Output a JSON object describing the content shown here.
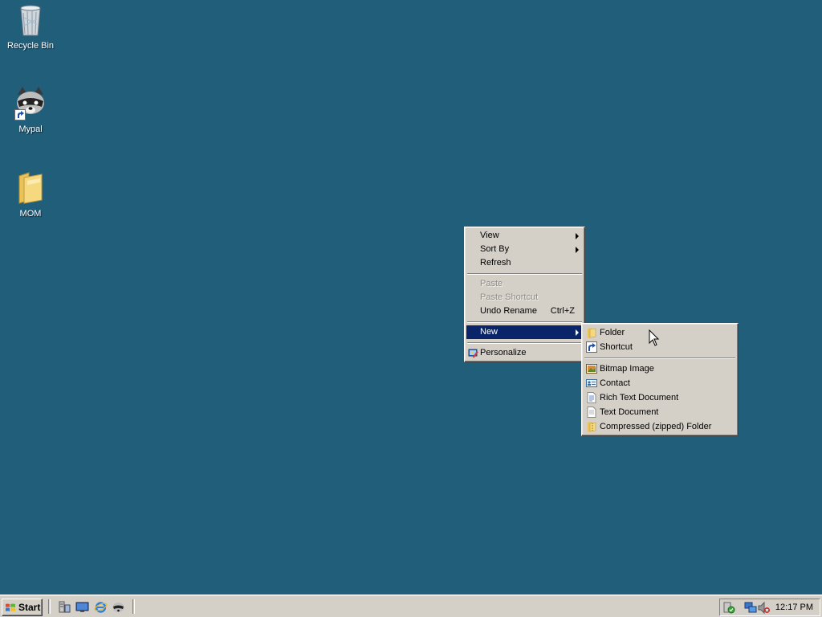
{
  "desktop": {
    "icons": [
      {
        "label": "Recycle Bin",
        "icon": "recycle-bin-icon"
      },
      {
        "label": "Mypal",
        "icon": "raccoon-app-icon"
      },
      {
        "label": "MOM",
        "icon": "folder-icon"
      }
    ]
  },
  "context_menu": {
    "items": [
      {
        "label": "View",
        "submenu": true
      },
      {
        "label": "Sort By",
        "submenu": true
      },
      {
        "label": "Refresh"
      },
      {
        "label": "Paste",
        "disabled": true
      },
      {
        "label": "Paste Shortcut",
        "disabled": true
      },
      {
        "label": "Undo Rename",
        "accel": "Ctrl+Z"
      },
      {
        "label": "New",
        "submenu": true,
        "selected": true
      },
      {
        "label": "Personalize",
        "icon": "personalize-icon"
      }
    ]
  },
  "new_submenu": {
    "items": [
      {
        "label": "Folder",
        "icon": "folder-icon"
      },
      {
        "label": "Shortcut",
        "icon": "shortcut-icon"
      },
      {
        "label": "Bitmap Image",
        "icon": "bitmap-image-icon"
      },
      {
        "label": "Contact",
        "icon": "contact-icon"
      },
      {
        "label": "Rich Text Document",
        "icon": "rich-text-document-icon"
      },
      {
        "label": "Text Document",
        "icon": "text-document-icon"
      },
      {
        "label": "Compressed (zipped) Folder",
        "icon": "zipped-folder-icon"
      }
    ]
  },
  "taskbar": {
    "start_label": "Start",
    "quick_launch": [
      "server-manager-icon",
      "show-desktop-icon",
      "internet-explorer-icon",
      "raccoon-app-icon"
    ],
    "tray_icons": [
      "security-icon",
      "network-icon",
      "volume-muted-icon"
    ],
    "clock": "12:17 PM"
  },
  "colors": {
    "desktop_bg": "#215e7a",
    "menu_bg": "#d4d0c8",
    "selection": "#0a246a"
  }
}
